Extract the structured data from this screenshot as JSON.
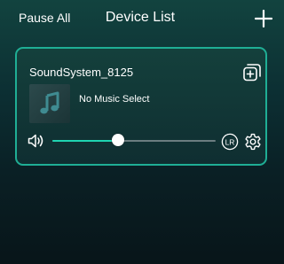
{
  "header": {
    "pause_all_label": "Pause All",
    "title": "Device List",
    "add_icon": "plus-icon"
  },
  "device": {
    "name": "SoundSystem_8125",
    "group_icon": "add-group-icon",
    "album_art_icon": "music-note-icon",
    "track_title": "No Music Select",
    "speaker_icon": "speaker-icon",
    "volume": 0.4,
    "lr_label": "LR",
    "settings_icon": "gear-icon"
  },
  "colors": {
    "accent": "#1fd4b1",
    "card_border": "#1fae95",
    "background_top": "#12433f",
    "background_bottom": "#081519"
  }
}
